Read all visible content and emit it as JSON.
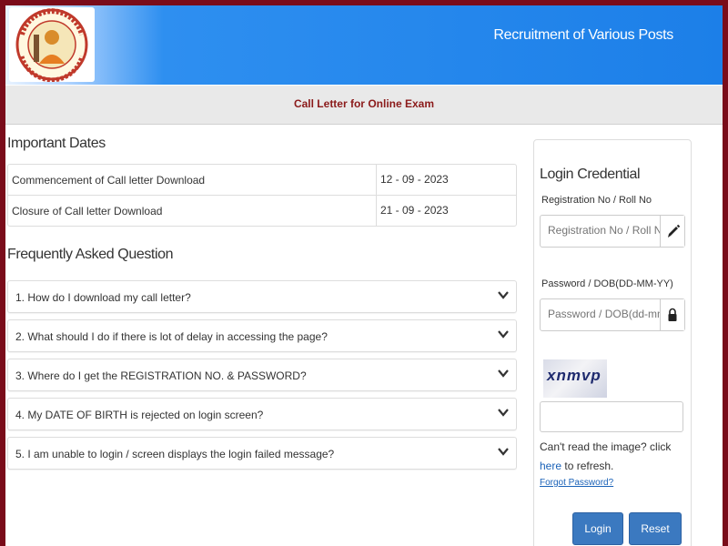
{
  "header": {
    "title": "Recruitment of Various Posts"
  },
  "subheader": {
    "title": "Call Letter for Online Exam"
  },
  "important_dates": {
    "title": "Important Dates",
    "rows": [
      {
        "label": "Commencement of Call letter Download",
        "value": "12 - 09 - 2023"
      },
      {
        "label": "Closure of Call letter Download",
        "value": "21 - 09 - 2023"
      }
    ]
  },
  "faq": {
    "title": "Frequently Asked Question",
    "items": [
      "1. How do I download my call letter?",
      "2. What should I do if there is lot of delay in accessing the page?",
      "3. Where do I get the REGISTRATION NO. & PASSWORD?",
      "4. My DATE OF BIRTH is rejected on login screen?",
      "5. I am unable to login / screen displays the login failed message?"
    ]
  },
  "login": {
    "title": "Login Credential",
    "reg_label": "Registration No / Roll No",
    "reg_placeholder": "Registration No / Roll No",
    "pwd_label": "Password / DOB(DD-MM-YY)",
    "pwd_placeholder": "Password / DOB(dd-mm-yy)",
    "captcha_text": "xnmvp",
    "help_prefix": "Can't read the image? click ",
    "help_link": "here",
    "help_suffix": " to refresh.",
    "forgot": "Forgot Password?",
    "login_button": "Login",
    "reset_button": "Reset"
  },
  "colors": {
    "border": "#7a0c1a",
    "header_blue": "#1c7fe8",
    "accent_red": "#8b1a1a",
    "button_blue": "#3b79c0",
    "link_blue": "#1a62b8"
  },
  "icons": [
    "logo-emblem",
    "chevron-down-icon",
    "pencil-icon",
    "lock-icon"
  ]
}
